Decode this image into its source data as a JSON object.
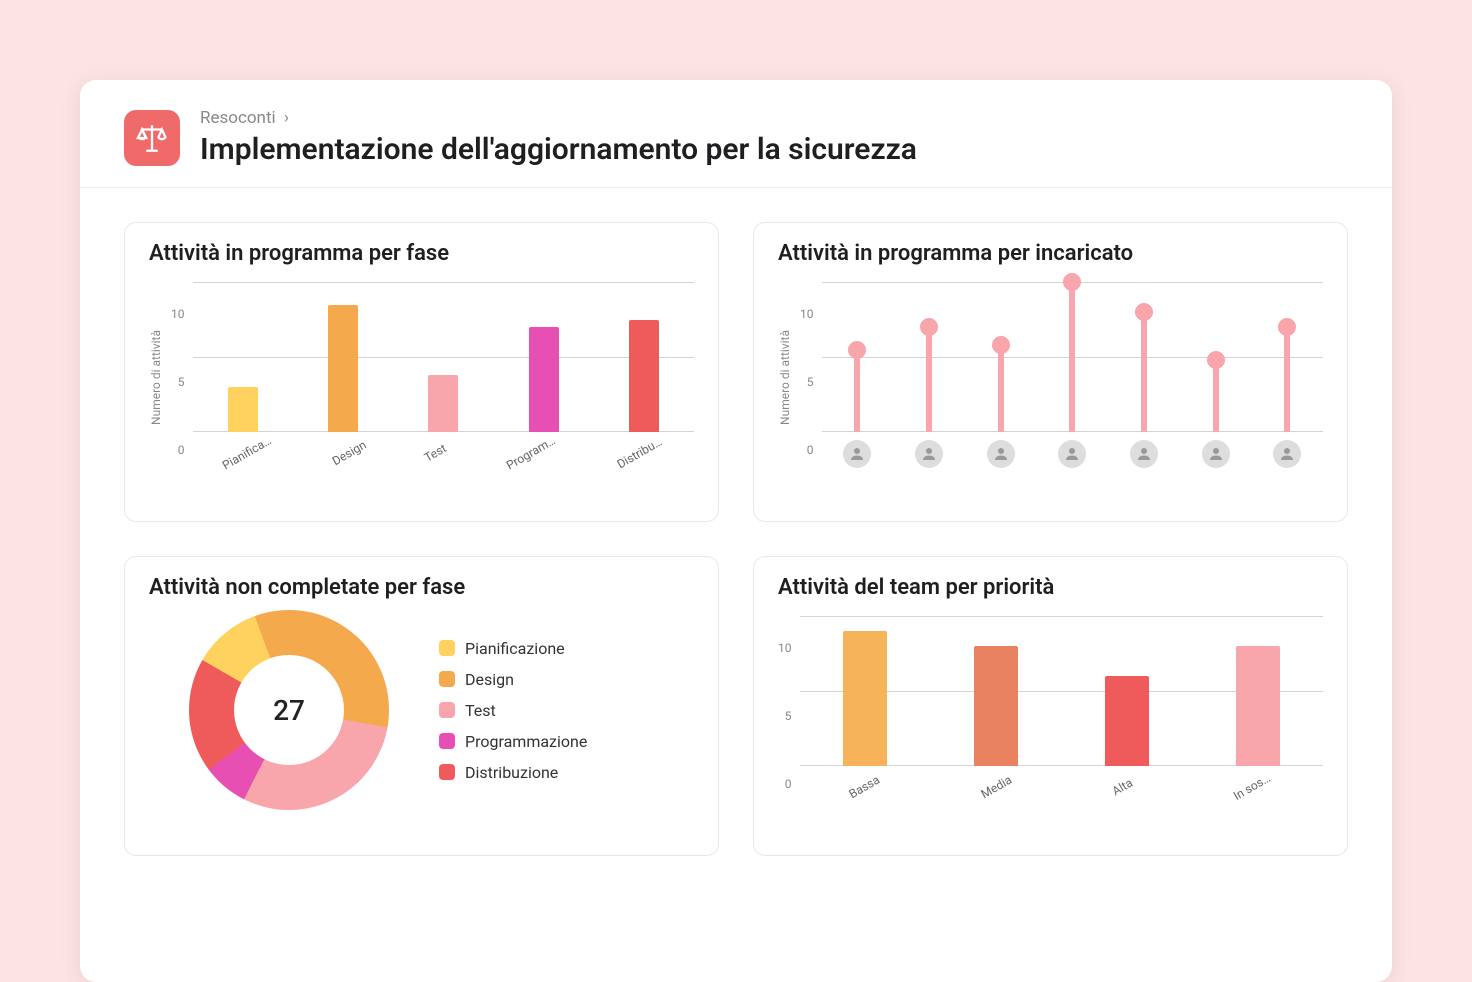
{
  "header": {
    "breadcrumb": "Resoconti",
    "title": "Implementazione dell'aggiornamento per la sicurezza"
  },
  "cards": {
    "phase": {
      "title": "Attività in programma per fase",
      "ylabel": "Numero di attività"
    },
    "assignee": {
      "title": "Attività in programma per incaricato",
      "ylabel": "Numero di attività"
    },
    "incomplete": {
      "title": "Attività non completate per fase",
      "center": "27"
    },
    "priority": {
      "title": "Attività del team per priorità"
    }
  },
  "legend": {
    "pianificazione": "Pianificazione",
    "design": "Design",
    "test": "Test",
    "programmazione": "Programmazione",
    "distribuzione": "Distribuzione"
  },
  "colors": {
    "pianificazione": "#ffd25f",
    "design": "#f5a94d",
    "test": "#f8a6ab",
    "programmazione": "#e84fb3",
    "distribuzione": "#ef5b5b",
    "priority_bassa": "#f6b35a",
    "priority_media": "#e98260",
    "priority_alta": "#ef5b5b",
    "priority_sos": "#f8a6ab"
  },
  "ticks": {
    "t10": "10",
    "t5": "5",
    "t0": "0"
  },
  "chart_data": [
    {
      "id": "phase",
      "type": "bar",
      "title": "Attività in programma per fase",
      "ylabel": "Numero di attività",
      "ylim": [
        0,
        10
      ],
      "categories": [
        "Pianifica…",
        "Design",
        "Test",
        "Program…",
        "Distribu…"
      ],
      "values": [
        3,
        8.5,
        3.8,
        7,
        7.5
      ],
      "colors": [
        "#ffd25f",
        "#f5a94d",
        "#f8a6ab",
        "#e84fb3",
        "#ef5b5b"
      ]
    },
    {
      "id": "assignee",
      "type": "bar",
      "title": "Attività in programma per incaricato",
      "ylabel": "Numero di attività",
      "ylim": [
        0,
        10
      ],
      "categories": [
        "Assignee 1",
        "Assignee 2",
        "Assignee 3",
        "Assignee 4",
        "Assignee 5",
        "Assignee 6",
        "Assignee 7"
      ],
      "values": [
        5.5,
        7,
        5.8,
        10,
        8,
        4.8,
        7
      ],
      "color": "#f8a6ab"
    },
    {
      "id": "incomplete",
      "type": "pie",
      "title": "Attività non completate per fase",
      "total": 27,
      "series": [
        {
          "name": "Pianificazione",
          "value": 3,
          "color": "#ffd25f"
        },
        {
          "name": "Design",
          "value": 9,
          "color": "#f5a94d"
        },
        {
          "name": "Test",
          "value": 8,
          "color": "#f8a6ab"
        },
        {
          "name": "Programmazione",
          "value": 2,
          "color": "#e84fb3"
        },
        {
          "name": "Distribuzione",
          "value": 5,
          "color": "#ef5b5b"
        }
      ]
    },
    {
      "id": "priority",
      "type": "bar",
      "title": "Attività del team per priorità",
      "ylim": [
        0,
        10
      ],
      "categories": [
        "Bassa",
        "Media",
        "Alta",
        "In sos…"
      ],
      "values": [
        9,
        8,
        6,
        8
      ],
      "colors": [
        "#f6b35a",
        "#e98260",
        "#ef5b5b",
        "#f8a6ab"
      ]
    }
  ]
}
